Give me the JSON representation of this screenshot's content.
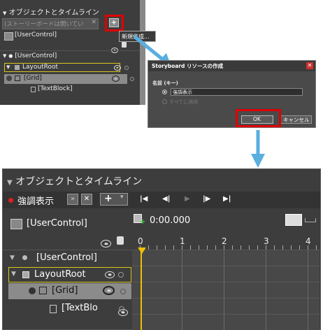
{
  "top_panel": {
    "title": "オブジェクトとタイムライン",
    "search_placeholder": "(ストーリーボードは開いてい",
    "user_control": "[UserControl]",
    "tree_user_control": "[UserControl]",
    "layout_root": "LayoutRoot",
    "grid": "[Grid]",
    "textblock": "[TextBlock]",
    "tooltip": "新規作成..."
  },
  "dialog": {
    "title": "Storyboard リソースの作成",
    "name_label": "名前 (キー)",
    "name_value": "強調表示",
    "apply_all": "すべてに適用",
    "ok": "OK",
    "cancel": "キャンセル"
  },
  "bottom_panel": {
    "title": "オブジェクトとタイムライン",
    "storyboard_name": "強調表示",
    "user_control": "[UserControl]",
    "time": "0:00.000",
    "tree_user_control": "[UserControl]",
    "layout_root": "LayoutRoot",
    "grid": "[Grid]",
    "textblock": "[TextBlo",
    "ruler": [
      "0",
      "1",
      "2",
      "3",
      "4"
    ]
  },
  "colors": {
    "panel": "#3d3d3d",
    "highlight_red": "#e00000",
    "arrow_blue": "#5aaee0",
    "selection_yellow": "#d8c81a",
    "timeline_playhead": "#f0c000"
  }
}
